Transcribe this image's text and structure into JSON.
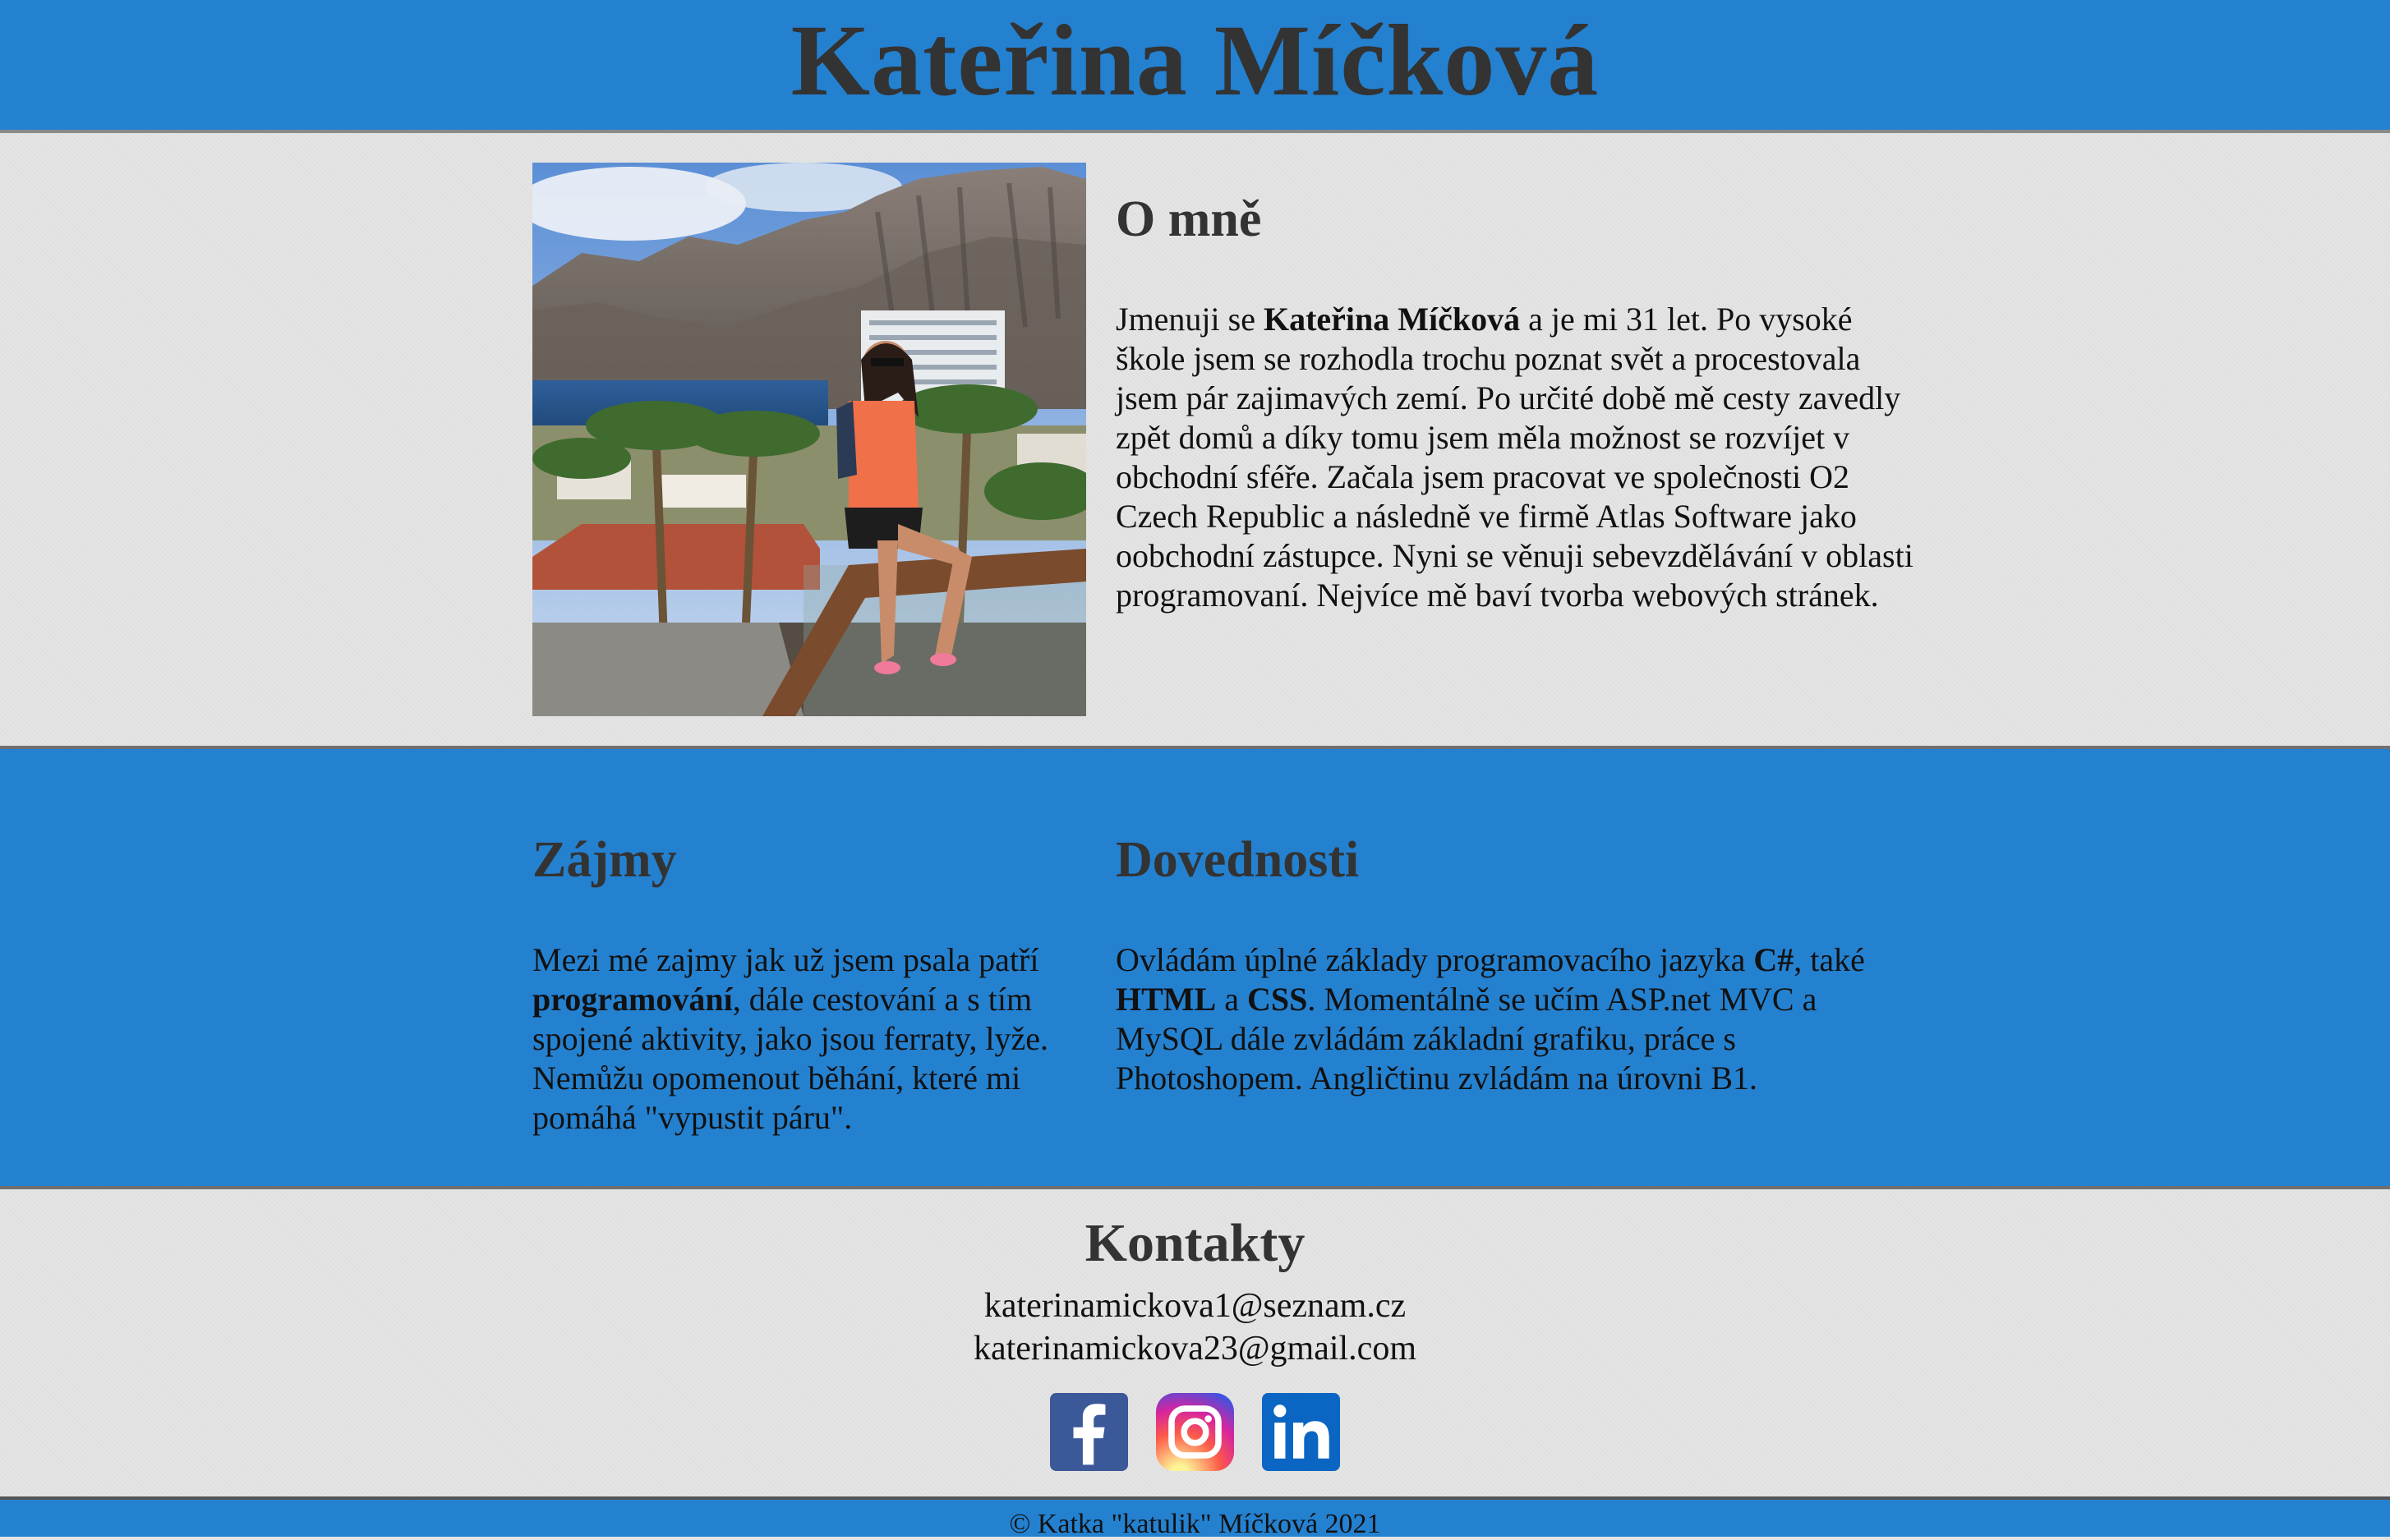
{
  "header": {
    "name": "Kateřina Míčková"
  },
  "about": {
    "title": "O mně",
    "text_before": "Jmenuji se ",
    "name_bold": "Kateřina Míčková",
    "text_after": " a je mi 31 let. Po vysoké škole jsem se rozhodla trochu poznat svět a procestovala jsem pár zajimavých zemí. Po určité době mě cesty zavedly zpět domů a díky tomu jsem měla možnost se rozvíjet v obchodní sféře. Začala jsem pracovat ve společnosti O2 Czech Republic a následně ve firmě Atlas Software jako oobchodní zástupce. Nyni se věnuji sebevzdělávání v oblasti programovaní. Nejvíce mě baví tvorba webových stránek."
  },
  "interests": {
    "title": "Zájmy",
    "text_before": "Mezi mé zajmy jak už jsem psala patří ",
    "bold": "programování",
    "text_after": ", dále cestování a s tím spojené aktivity, jako jsou ferraty, lyže. Nemůžu opomenout běhání, které mi pomáhá \"vypustit páru\"."
  },
  "skills": {
    "title": "Dovednosti",
    "text_1": "Ovládám úplné základy programovacího jazyka ",
    "bold_csharp": "C#",
    "text_2": ", také ",
    "bold_html": "HTML",
    "text_3": " a ",
    "bold_css": "CSS",
    "text_4": ". Momentálně se učím ASP.net MVC a MySQL dále zvládám základní grafiku, práce s Photoshopem. Angličtinu zvládám na úrovni B1."
  },
  "contacts": {
    "title": "Kontakty",
    "email_1": "katerinamickova1@seznam.cz",
    "email_2": "katerinamickova23@gmail.com",
    "socials": [
      {
        "icon": "facebook-icon",
        "color": "#3b5998"
      },
      {
        "icon": "instagram-icon",
        "color": "#d6249f"
      },
      {
        "icon": "linkedin-icon",
        "color": "#0a66c2"
      }
    ]
  },
  "footer": {
    "text": "© Katka \"katulik\" Míčková 2021"
  },
  "colors": {
    "blue": "#2481d0",
    "gray": "#e3e3e3",
    "heading": "#333333"
  }
}
